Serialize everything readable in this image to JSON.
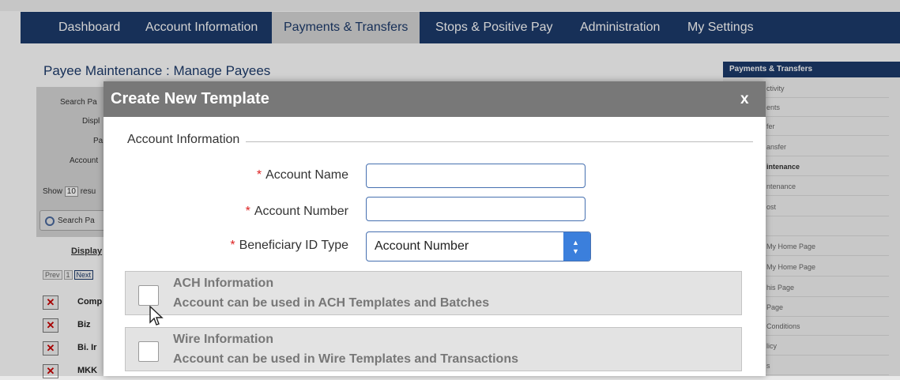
{
  "nav": {
    "items": [
      {
        "label": "Dashboard"
      },
      {
        "label": "Account Information"
      },
      {
        "label": "Payments & Transfers",
        "active": true
      },
      {
        "label": "Stops & Positive Pay"
      },
      {
        "label": "Administration"
      },
      {
        "label": "My Settings"
      }
    ]
  },
  "page": {
    "title": "Payee Maintenance : Manage Payees",
    "search_panel": {
      "label_search": "Search Pa",
      "label_display": "Displ",
      "label_payee": "Pa",
      "label_account": "Account"
    },
    "show_prefix": "Show",
    "show_value": "10",
    "show_suffix": "resu",
    "search_button": "Search Pa",
    "display_label": "Display",
    "pager": {
      "prev": "Prev",
      "page": "1",
      "next": "Next"
    },
    "payees": [
      "Comp",
      "Biz",
      "Bi. Ir",
      "MKK"
    ]
  },
  "sidebar": {
    "header": "Payments & Transfers",
    "items": [
      {
        "label": "ctivity"
      },
      {
        "label": "ents"
      },
      {
        "label": "fer"
      },
      {
        "label": "ansfer"
      },
      {
        "label": "intenance",
        "bold": true
      },
      {
        "label": "ntenance"
      },
      {
        "label": "ost"
      },
      {
        "label": ""
      },
      {
        "label": "My Home Page"
      },
      {
        "label": "My Home Page"
      },
      {
        "label": "his Page"
      },
      {
        "label": "Page"
      },
      {
        "label": "Conditions"
      },
      {
        "label": "licy"
      },
      {
        "label": "s"
      }
    ]
  },
  "modal": {
    "title": "Create New Template",
    "close": "x",
    "section": "Account Information",
    "required_mark": "*",
    "fields": {
      "account_name": {
        "label": "Account Name",
        "value": ""
      },
      "account_number": {
        "label": "Account Number",
        "value": ""
      },
      "beneficiary_id_type": {
        "label": "Beneficiary ID Type",
        "value": "Account Number"
      }
    },
    "ach": {
      "title": "ACH Information",
      "desc": "Account can be used in ACH Templates and Batches",
      "checked": false
    },
    "wire": {
      "title": "Wire Information",
      "desc": "Account can be used in Wire Templates and Transactions",
      "checked": false
    }
  },
  "colors": {
    "nav_bg": "#1d3b6c",
    "modal_header": "#787878",
    "required": "#d22",
    "select_accent": "#3b7fdc"
  },
  "icons": [
    "search-icon",
    "delete-x-icon",
    "close-icon",
    "select-arrows-icon",
    "mouse-pointer-icon"
  ]
}
